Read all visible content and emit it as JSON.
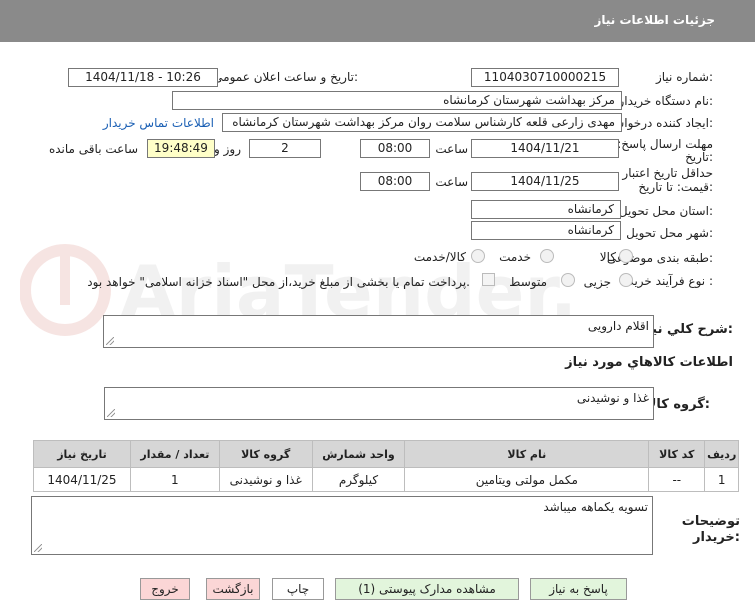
{
  "header": {
    "title": "جزئیات اطلاعات نیاز"
  },
  "fields": {
    "need_number_label": "شماره نیاز:",
    "need_number": "1104030710000215",
    "announce_label": "تاریخ و ساعت اعلان عمومی:",
    "announce_value": "1404/11/18 - 10:26",
    "buyer_org_label": "نام دستگاه خریدار:",
    "buyer_org": "مرکز بهداشت شهرستان کرمانشاه",
    "creator_label": "ایجاد کننده درخواست:",
    "creator": "مهدی  زارعی قلعه کارشناس سلامت روان مرکز بهداشت شهرستان کرمانشاه",
    "contact_link": "اطلاعات تماس خریدار",
    "deadline_label_1": "مهلت ارسال پاسخ: تا",
    "deadline_label_2": "تاریخ:",
    "deadline_date": "1404/11/21",
    "time_label": "ساعت",
    "deadline_time": "08:00",
    "days_value": "2",
    "days_label": "روز و",
    "remaining_time": "19:48:49",
    "remaining_label": "ساعت باقی مانده",
    "validity_label_1": "حداقل تاریخ اعتبار",
    "validity_label_2": "قیمت: تا تاریخ:",
    "validity_date": "1404/11/25",
    "validity_time": "08:00",
    "province_label": "استان محل تحویل:",
    "province": "کرمانشاه",
    "city_label": "شهر محل تحویل:",
    "city": "کرمانشاه",
    "category_label": "طبقه بندی موضوعی:",
    "category_options": [
      "کالا",
      "خدمت",
      "کالا/خدمت"
    ],
    "process_label": "نوع فرآیند خرید :",
    "process_options": [
      "جزیی",
      "متوسط"
    ],
    "payment_note": "پرداخت تمام یا بخشی از مبلغ خرید،از محل \"اسناد خزانه اسلامی\" خواهد بود."
  },
  "description": {
    "label": "شرح کلي نياز:",
    "value": "اقلام دارویی"
  },
  "goods": {
    "section_title": "اطلاعات کالاهاي مورد نياز",
    "group_label": "گروه کالا:",
    "group_value": "غذا و نوشیدنی",
    "table": {
      "headers": [
        "ردیف",
        "کد کالا",
        "نام کالا",
        "واحد شمارش",
        "گروه کالا",
        "تعداد / مقدار",
        "تاریخ نیاز"
      ],
      "rows": [
        [
          "1",
          "--",
          "مکمل مولتی ویتامین",
          "کیلوگرم",
          "غذا و نوشیدنی",
          "1",
          "1404/11/25"
        ]
      ]
    }
  },
  "buyer_notes": {
    "label_1": "توضیحات",
    "label_2": "خریدار:",
    "value": "تسویه یکماهه میباشد"
  },
  "buttons": {
    "reply": "پاسخ به نیاز",
    "attachments": "مشاهده مدارک پیوستی (1)",
    "print": "چاپ",
    "back": "بازگشت",
    "exit": "خروج"
  },
  "watermark": {
    "text": "AriaTender.neT"
  },
  "colors": {
    "titlebar": "#8a8a8a",
    "link": "#1a5fb4",
    "remaining_bg": "#ffffc8",
    "btn_green": "#e2f5dc",
    "btn_red": "#fbd6d6"
  }
}
